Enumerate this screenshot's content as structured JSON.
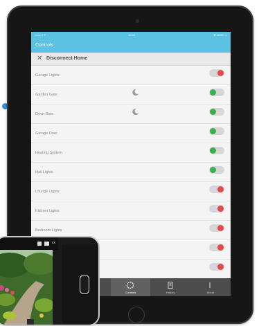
{
  "app": {
    "status": {
      "carrier": "•••oo 3 ✈",
      "time": "12:06",
      "battery": "✱ 100% ▭"
    },
    "title": "Controls",
    "disconnect_label": "Disconnect Home"
  },
  "devices": [
    {
      "label": "Garage Lights",
      "state": "off",
      "scheduled": false
    },
    {
      "label": "Garden Gate",
      "state": "on",
      "scheduled": true
    },
    {
      "label": "Drive Gate",
      "state": "on",
      "scheduled": true
    },
    {
      "label": "Garage Door",
      "state": "on",
      "scheduled": false
    },
    {
      "label": "Heating System",
      "state": "on",
      "scheduled": false
    },
    {
      "label": "Hall Lights",
      "state": "on",
      "scheduled": false
    },
    {
      "label": "Lounge Lights",
      "state": "off",
      "scheduled": false
    },
    {
      "label": "Kitchen Lights",
      "state": "off",
      "scheduled": false
    },
    {
      "label": "Bedroom Lights",
      "state": "off",
      "scheduled": false
    },
    {
      "label": "",
      "state": "off",
      "scheduled": false
    },
    {
      "label": "",
      "state": "off",
      "scheduled": false
    }
  ],
  "tabs": [
    {
      "label": "",
      "icon": "home-icon"
    },
    {
      "label": "",
      "icon": "grid-icon"
    },
    {
      "label": "Controls",
      "icon": "power-ring-icon",
      "active": true
    },
    {
      "label": "History",
      "icon": "history-icon"
    },
    {
      "label": "About",
      "icon": "info-icon"
    }
  ],
  "phone": {
    "toolbar_text": "cx",
    "colors": {
      "accent": "#5bc2e3",
      "on": "#3bb04a",
      "off": "#e14a4a"
    }
  }
}
